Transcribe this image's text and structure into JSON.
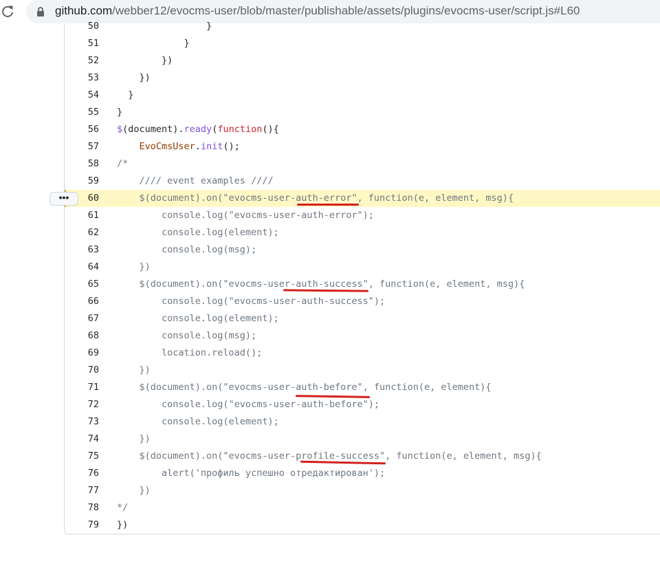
{
  "browser": {
    "url_host": "github.com",
    "url_path": "/webber12/evocms-user/blob/master/publishable/assets/plugins/evocms-user/script.js#L60"
  },
  "code": {
    "highlighted_line": 60,
    "line_menu_label": "•••",
    "lines": [
      {
        "n": "50",
        "tokens": [
          {
            "t": "                }",
            "k": ""
          }
        ]
      },
      {
        "n": "51",
        "tokens": [
          {
            "t": "            }",
            "k": ""
          }
        ]
      },
      {
        "n": "52",
        "tokens": [
          {
            "t": "        })",
            "k": ""
          }
        ]
      },
      {
        "n": "53",
        "tokens": [
          {
            "t": "    })",
            "k": ""
          }
        ]
      },
      {
        "n": "54",
        "tokens": [
          {
            "t": "  }",
            "k": ""
          }
        ]
      },
      {
        "n": "55",
        "tokens": [
          {
            "t": "}",
            "k": ""
          }
        ]
      },
      {
        "n": "56",
        "tokens": [
          {
            "t": "$",
            "k": "fn"
          },
          {
            "t": "(document).",
            "k": ""
          },
          {
            "t": "ready",
            "k": "fn"
          },
          {
            "t": "(",
            "k": ""
          },
          {
            "t": "function",
            "k": "kw"
          },
          {
            "t": "(){",
            "k": ""
          }
        ]
      },
      {
        "n": "57",
        "tokens": [
          {
            "t": "    ",
            "k": ""
          },
          {
            "t": "EvoCmsUser",
            "k": "var"
          },
          {
            "t": ".",
            "k": ""
          },
          {
            "t": "init",
            "k": "fn"
          },
          {
            "t": "();",
            "k": ""
          }
        ]
      },
      {
        "n": "58",
        "tokens": [
          {
            "t": "/*",
            "k": "cmt"
          }
        ]
      },
      {
        "n": "59",
        "tokens": [
          {
            "t": "    //// event examples ////",
            "k": "cmt"
          }
        ]
      },
      {
        "n": "60",
        "tokens": [
          {
            "t": "    $(document).on(\"evocms-user-auth-error\", function(e, element, msg){",
            "k": "cmt"
          }
        ]
      },
      {
        "n": "61",
        "tokens": [
          {
            "t": "        console.log(\"evocms-user-auth-error\");",
            "k": "cmt"
          }
        ]
      },
      {
        "n": "62",
        "tokens": [
          {
            "t": "        console.log(element);",
            "k": "cmt"
          }
        ]
      },
      {
        "n": "63",
        "tokens": [
          {
            "t": "        console.log(msg);",
            "k": "cmt"
          }
        ]
      },
      {
        "n": "64",
        "tokens": [
          {
            "t": "    })",
            "k": "cmt"
          }
        ]
      },
      {
        "n": "65",
        "tokens": [
          {
            "t": "    $(document).on(\"evocms-user-auth-success\", function(e, element, msg){",
            "k": "cmt"
          }
        ]
      },
      {
        "n": "66",
        "tokens": [
          {
            "t": "        console.log(\"evocms-user-auth-success\");",
            "k": "cmt"
          }
        ]
      },
      {
        "n": "67",
        "tokens": [
          {
            "t": "        console.log(element);",
            "k": "cmt"
          }
        ]
      },
      {
        "n": "68",
        "tokens": [
          {
            "t": "        console.log(msg);",
            "k": "cmt"
          }
        ]
      },
      {
        "n": "69",
        "tokens": [
          {
            "t": "        location.reload();",
            "k": "cmt"
          }
        ]
      },
      {
        "n": "70",
        "tokens": [
          {
            "t": "    })",
            "k": "cmt"
          }
        ]
      },
      {
        "n": "71",
        "tokens": [
          {
            "t": "    $(document).on(\"evocms-user-auth-before\", function(e, element){",
            "k": "cmt"
          }
        ]
      },
      {
        "n": "72",
        "tokens": [
          {
            "t": "        console.log(\"evocms-user-auth-before\");",
            "k": "cmt"
          }
        ]
      },
      {
        "n": "73",
        "tokens": [
          {
            "t": "        console.log(element);",
            "k": "cmt"
          }
        ]
      },
      {
        "n": "74",
        "tokens": [
          {
            "t": "    })",
            "k": "cmt"
          }
        ]
      },
      {
        "n": "75",
        "tokens": [
          {
            "t": "    $(document).on(\"evocms-user-profile-success\", function(e, element, msg){",
            "k": "cmt"
          }
        ]
      },
      {
        "n": "76",
        "tokens": [
          {
            "t": "        alert('профиль успешно отредактирован');",
            "k": "cmt"
          }
        ]
      },
      {
        "n": "77",
        "tokens": [
          {
            "t": "    })",
            "k": "cmt"
          }
        ]
      },
      {
        "n": "78",
        "tokens": [
          {
            "t": "*/",
            "k": "cmt"
          }
        ]
      },
      {
        "n": "79",
        "tokens": [
          {
            "t": "})",
            "k": ""
          }
        ]
      }
    ]
  },
  "annotations": {
    "color": "#d3201f"
  }
}
